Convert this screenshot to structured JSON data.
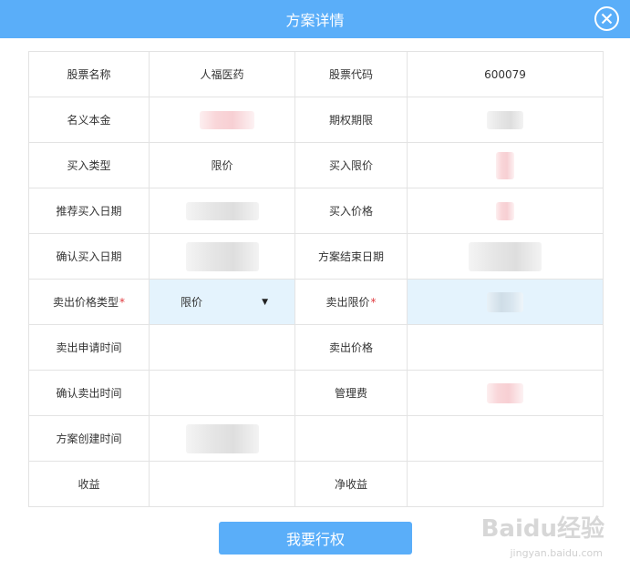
{
  "dialog": {
    "title": "方案详情",
    "submit_label": "我要行权",
    "colors": {
      "header": "#5aaef9",
      "highlight_row": "#e4f3fd",
      "required_mark": "#e0393e"
    }
  },
  "rows": [
    {
      "l1": "股票名称",
      "v1": "人福医药",
      "l2": "股票代码",
      "v2": "600079"
    },
    {
      "l1": "名义本金",
      "v1": "",
      "l2": "期权期限",
      "v2": ""
    },
    {
      "l1": "买入类型",
      "v1": "限价",
      "l2": "买入限价",
      "v2": ""
    },
    {
      "l1": "推荐买入日期",
      "v1": "",
      "l2": "买入价格",
      "v2": ""
    },
    {
      "l1": "确认买入日期",
      "v1": "",
      "l2": "方案结束日期",
      "v2": ""
    },
    {
      "l1": "卖出价格类型",
      "v1": "限价",
      "l2": "卖出限价",
      "v2": ""
    },
    {
      "l1": "卖出申请时间",
      "v1": "",
      "l2": "卖出价格",
      "v2": ""
    },
    {
      "l1": "确认卖出时间",
      "v1": "",
      "l2": "管理费",
      "v2": ""
    },
    {
      "l1": "方案创建时间",
      "v1": "",
      "l2": "",
      "v2": ""
    },
    {
      "l1": "收益",
      "v1": "",
      "l2": "净收益",
      "v2": ""
    }
  ],
  "required_mark": "*",
  "icons": {
    "close": "close-icon",
    "dropdown": "caret-down-icon"
  },
  "watermark": {
    "brand": "Baidu经验",
    "url": "jingyan.baidu.com"
  }
}
